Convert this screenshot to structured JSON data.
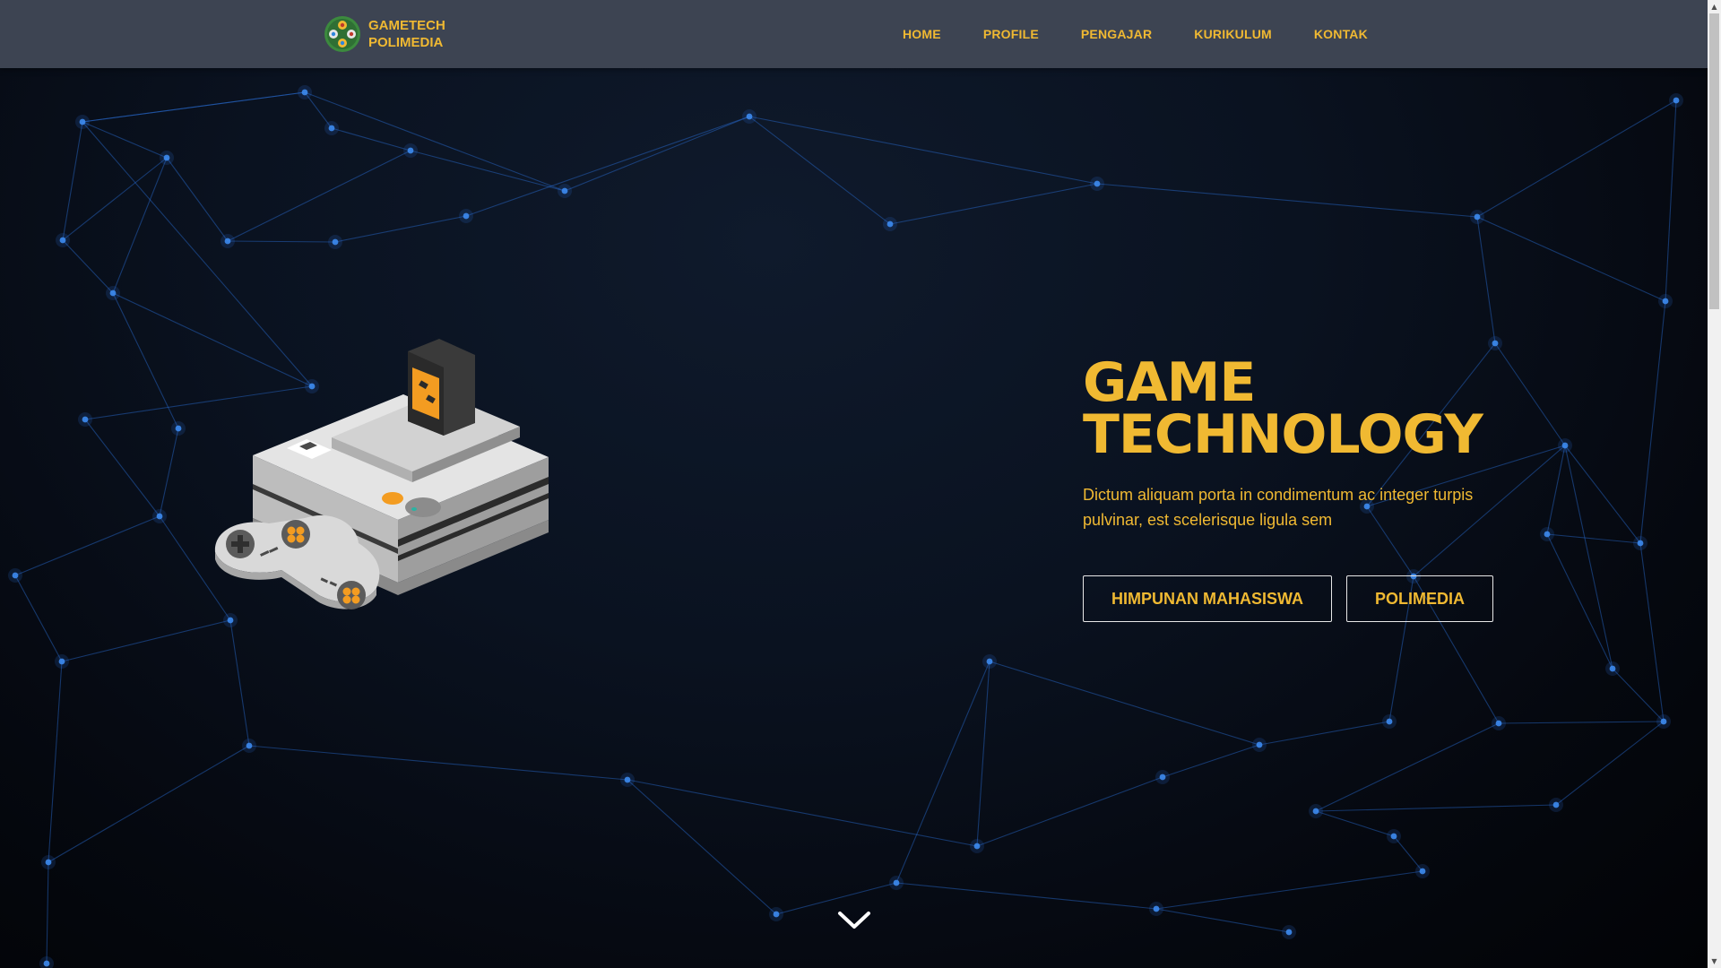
{
  "brand": {
    "line1": "GAMETECH",
    "line2": "POLIMEDIA",
    "logo_icon": "gamepad-buttons-logo-icon"
  },
  "nav": {
    "items": [
      {
        "label": "HOME"
      },
      {
        "label": "PROFILE"
      },
      {
        "label": "PENGAJAR"
      },
      {
        "label": "KURIKULUM"
      },
      {
        "label": "KONTAK"
      }
    ]
  },
  "hero": {
    "title_line1": "GAME",
    "title_line2": "TECHNOLOGY",
    "description": "Dictum aliquam porta in condimentum ac integer turpis pulvinar, est scelerisque ligula sem",
    "buttons": [
      {
        "label": "HIMPUNAN MAHASISWA"
      },
      {
        "label": "POLIMEDIA"
      }
    ],
    "illustration": "retro-game-console-illustration"
  },
  "scroll": {
    "icon": "chevron-down-icon"
  },
  "colors": {
    "accent": "#f0b932",
    "navbar": "#3d4452",
    "background": "#05070d",
    "network_lines": "#2a6fd6"
  }
}
